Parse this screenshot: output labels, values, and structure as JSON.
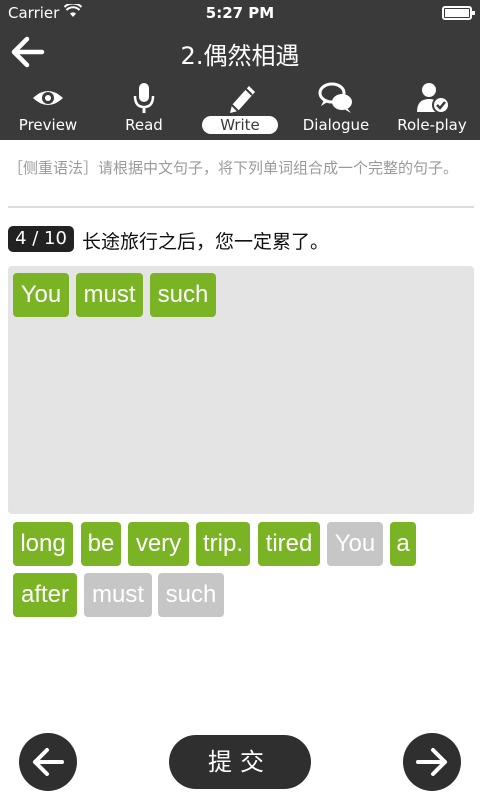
{
  "status": {
    "carrier": "Carrier",
    "time": "5:27 PM"
  },
  "header": {
    "title": "2.偶然相遇"
  },
  "tabs": [
    {
      "label": "Preview",
      "icon": "eye-icon"
    },
    {
      "label": "Read",
      "icon": "microphone-icon"
    },
    {
      "label": "Write",
      "icon": "pencil-icon",
      "active": true
    },
    {
      "label": "Dialogue",
      "icon": "speech-bubbles-icon"
    },
    {
      "label": "Role-play",
      "icon": "user-check-icon"
    }
  ],
  "instruction": "［侧重语法］请根据中文句子，将下列单词组合成一个完整的句子。",
  "question": {
    "progress": "4 / 10",
    "sentence": "长途旅行之后，您一定累了。"
  },
  "answer_words": [
    "You",
    "must",
    "such"
  ],
  "word_bank": [
    {
      "word": "long",
      "used": false
    },
    {
      "word": "be",
      "used": false
    },
    {
      "word": "very",
      "used": false
    },
    {
      "word": "trip.",
      "used": false
    },
    {
      "word": "tired",
      "used": false
    },
    {
      "word": "You",
      "used": true
    },
    {
      "word": "a",
      "used": false
    },
    {
      "word": "after",
      "used": false
    },
    {
      "word": "must",
      "used": true
    },
    {
      "word": "such",
      "used": true
    }
  ],
  "footer": {
    "submit_label": "提交"
  },
  "colors": {
    "bar": "#3a3a3a",
    "chip_active": "#7ab424",
    "chip_used": "#c6c6c6"
  }
}
